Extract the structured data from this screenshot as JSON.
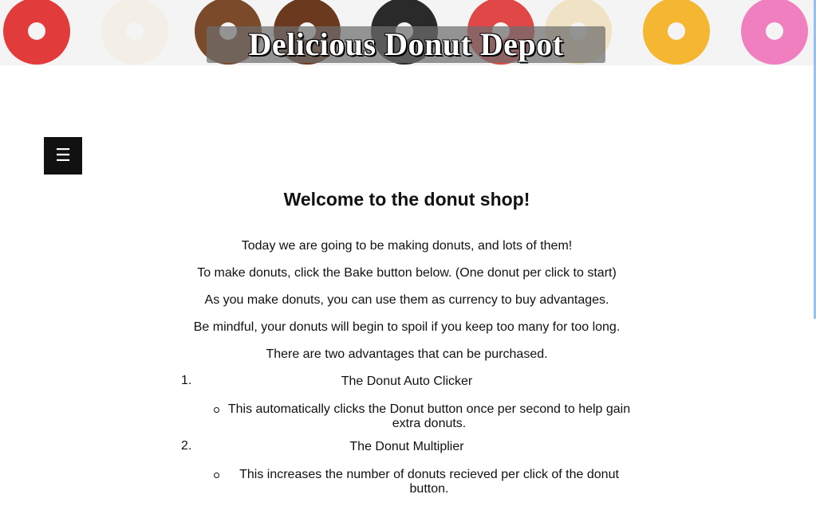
{
  "header": {
    "title": "Delicious Donut Depot"
  },
  "banner": {
    "donuts": [
      {
        "name": "red-sprinkle-donut-icon",
        "color": "#e23b3b"
      },
      {
        "name": "white-sprinkle-donut-icon",
        "color": "#f3eee6"
      },
      {
        "name": "chocolate-drizzle-donut-icon",
        "color": "#7a4a2a"
      },
      {
        "name": "chocolate-donut-icon",
        "color": "#6b3a1e"
      },
      {
        "name": "black-sprinkle-donut-icon",
        "color": "#2a2a2a"
      },
      {
        "name": "red-glazed-donut-icon",
        "color": "#e04848"
      },
      {
        "name": "white-drizzle-donut-icon",
        "color": "#f0e2c4"
      },
      {
        "name": "orange-drizzle-donut-icon",
        "color": "#f5b632"
      },
      {
        "name": "pink-sprinkle-donut-icon",
        "color": "#ef7fbf"
      }
    ]
  },
  "menu": {
    "icon": "☰"
  },
  "main": {
    "heading": "Welcome to the donut shop!",
    "paragraphs": [
      "Today we are going to be making donuts, and lots of them!",
      "To make donuts, click the Bake button below. (One donut per click to start)",
      "As you make donuts, you can use them as currency to buy advantages.",
      "Be mindful, your donuts will begin to spoil if you keep too many for too long.",
      "There are two advantages that can be purchased."
    ],
    "advantages": [
      {
        "number": "1.",
        "name": "The Donut Auto Clicker",
        "description": "This automatically clicks the Donut button once per second to help gain extra donuts."
      },
      {
        "number": "2.",
        "name": "The Donut Multiplier",
        "description": "This increases the number of donuts recieved per click of the donut button."
      }
    ]
  }
}
